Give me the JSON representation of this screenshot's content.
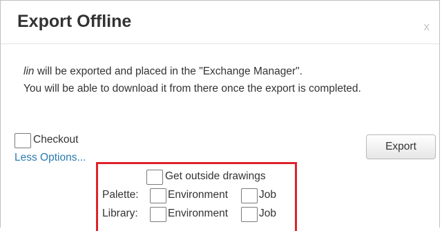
{
  "dialog": {
    "title": "Export Offline",
    "close_label": "x",
    "message_item": "lin",
    "message_line1_rest": " will be exported and placed in the \"Exchange Manager\".",
    "message_line2": "You will be able to download it from there once the export is completed."
  },
  "options": {
    "checkout_label": "Checkout",
    "less_options_label": "Less Options...",
    "export_label": "Export",
    "get_outside_drawings_label": "Get outside drawings",
    "palette_label": "Palette:",
    "library_label": "Library:",
    "environment_label": "Environment",
    "job_label": "Job",
    "checkout_checked": false,
    "get_outside_drawings_checked": false,
    "palette_environment_checked": false,
    "palette_job_checked": false,
    "library_environment_checked": false,
    "library_job_checked": false
  },
  "colors": {
    "highlight_border": "#e0212b",
    "link": "#2a7ab0"
  }
}
